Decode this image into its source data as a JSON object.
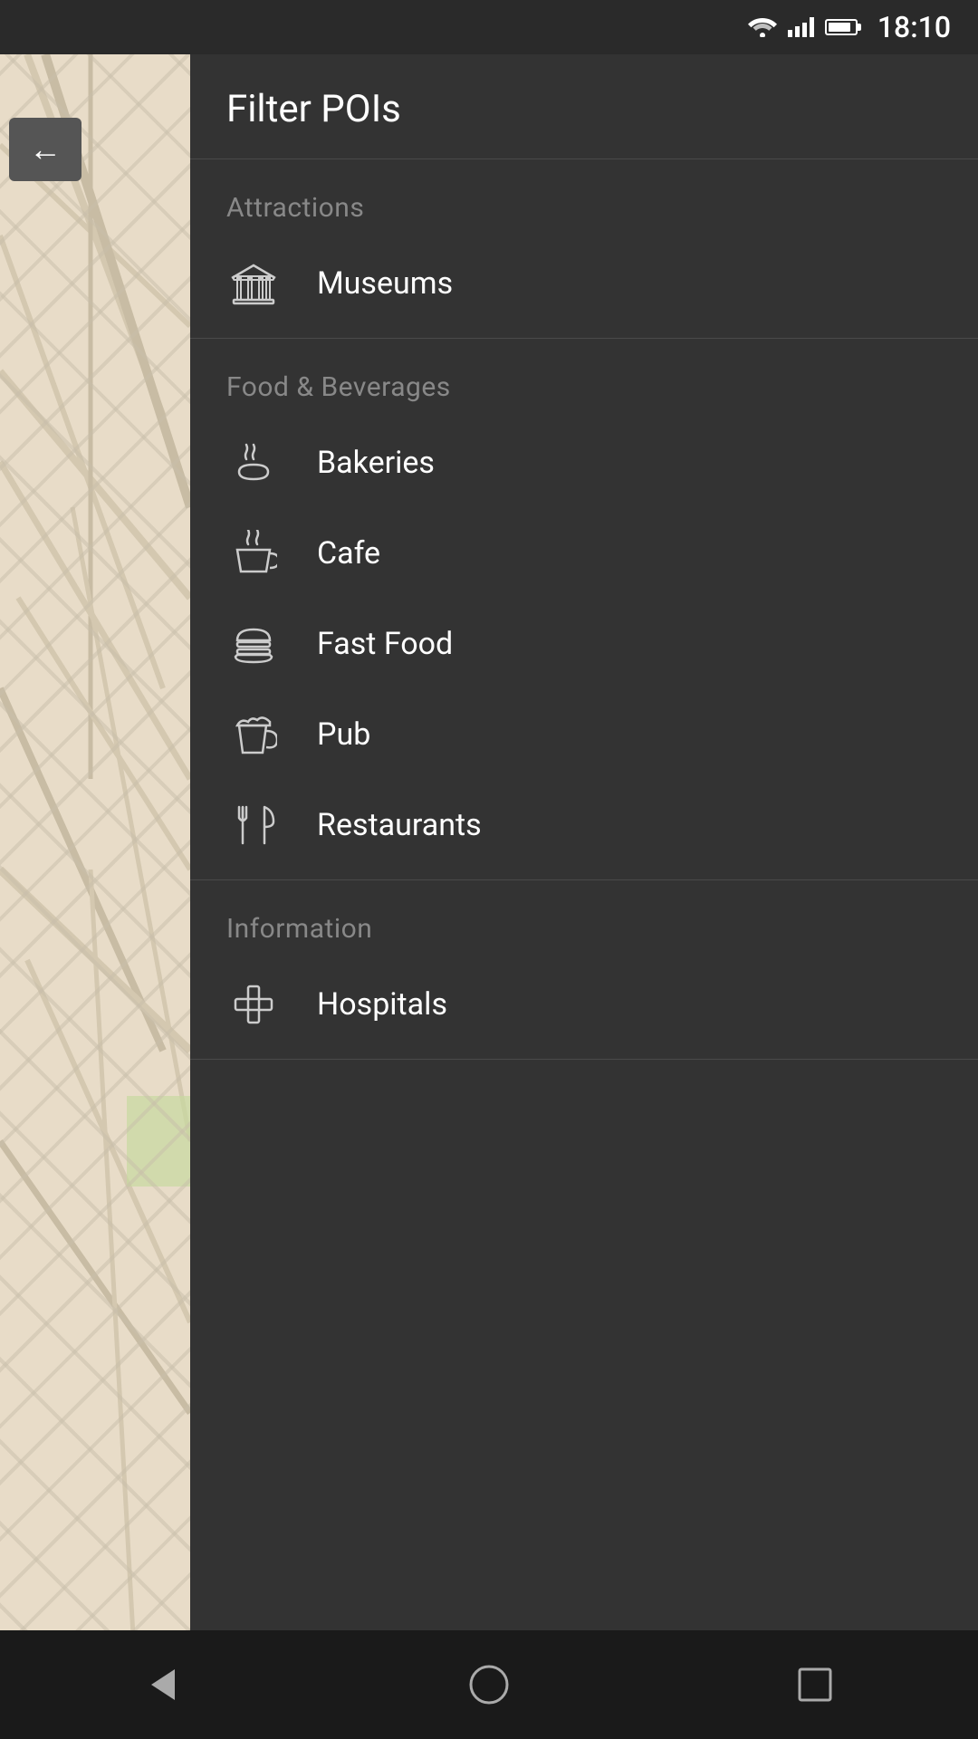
{
  "statusBar": {
    "time": "18:10"
  },
  "header": {
    "title": "Filter POIs",
    "backLabel": "Back"
  },
  "sections": [
    {
      "id": "attractions",
      "label": "Attractions",
      "items": [
        {
          "id": "museums",
          "label": "Museums",
          "icon": "museum"
        }
      ]
    },
    {
      "id": "food-beverages",
      "label": "Food & Beverages",
      "items": [
        {
          "id": "bakeries",
          "label": "Bakeries",
          "icon": "bakery"
        },
        {
          "id": "cafe",
          "label": "Cafe",
          "icon": "cafe"
        },
        {
          "id": "fast-food",
          "label": "Fast Food",
          "icon": "fastfood"
        },
        {
          "id": "pub",
          "label": "Pub",
          "icon": "pub"
        },
        {
          "id": "restaurants",
          "label": "Restaurants",
          "icon": "restaurant"
        }
      ]
    },
    {
      "id": "information",
      "label": "Information",
      "items": [
        {
          "id": "hospitals",
          "label": "Hospitals",
          "icon": "hospital"
        }
      ]
    }
  ],
  "bottomNav": {
    "back": "back",
    "home": "home",
    "recent": "recent"
  }
}
